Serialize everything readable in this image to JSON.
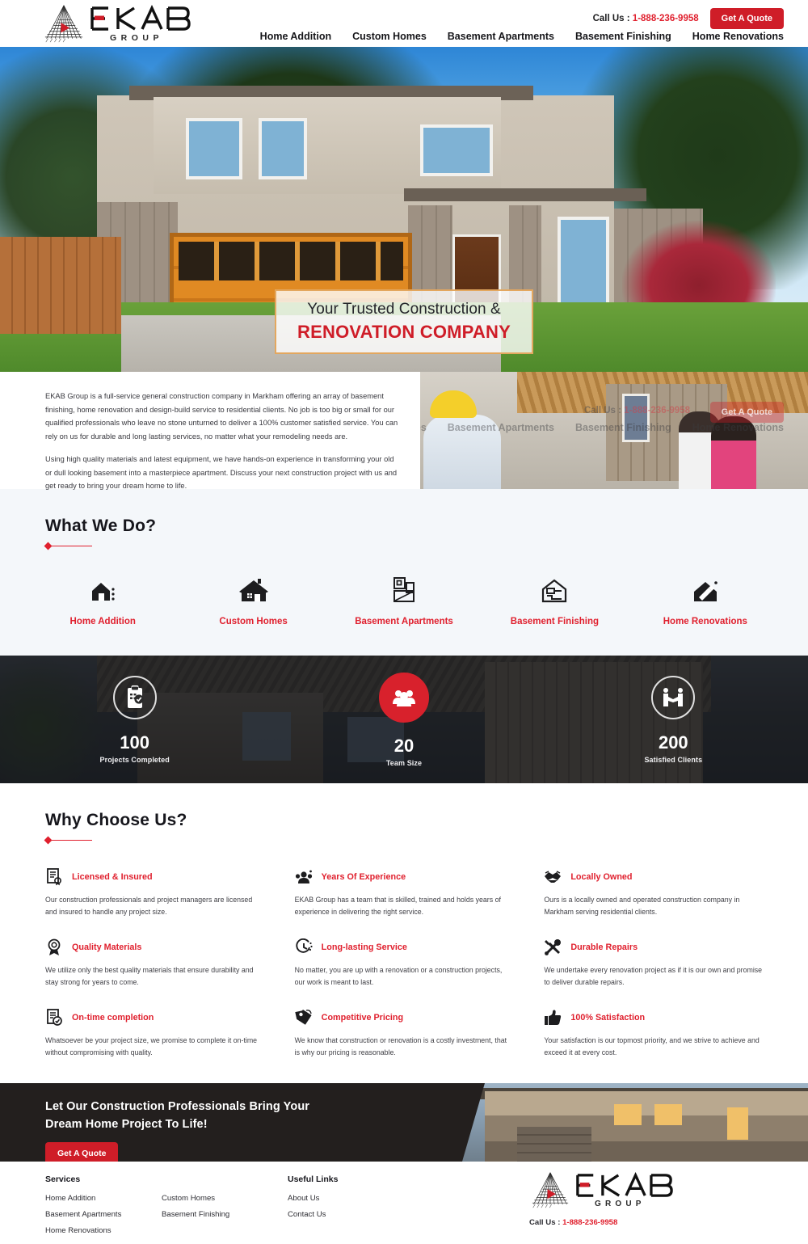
{
  "header": {
    "logo": {
      "word": "EKAB",
      "sub": "GROUP",
      "icon": "ekab-fan-logo"
    },
    "call_label": "Call Us :",
    "phone": "1-888-236-9958",
    "quote_button": "Get A Quote",
    "nav": [
      {
        "label": "Home Addition"
      },
      {
        "label": "Custom Homes"
      },
      {
        "label": "Basement Apartments"
      },
      {
        "label": "Basement Finishing"
      },
      {
        "label": "Home Renovations"
      }
    ]
  },
  "hero": {
    "line1": "Your Trusted Construction &",
    "line2": "RENOVATION COMPANY",
    "image_alt": "modern-home-exterior-with-wood-garage-door"
  },
  "intro": {
    "paragraph1": "EKAB Group is a full-service general construction company in Markham offering an array of basement finishing, home renovation and design-build service to residential clients. No job is too big or small for our qualified professionals who leave no stone unturned to deliver a 100% customer satisfied service. You can rely on us for durable and long lasting services, no matter what your remodeling needs are.",
    "paragraph2": "Using high quality materials and latest equipment, we have hands-on experience in transforming your old or dull looking basement into a masterpiece apartment. Discuss your next construction project with us and get ready to bring your dream home to life.",
    "image_alt": "contractor-in-yellow-hardhat-with-clients-at-construction-site"
  },
  "what_we_do": {
    "title": "What We Do?",
    "services": [
      {
        "label": "Home Addition",
        "icon": "house-addition-icon"
      },
      {
        "label": "Custom Homes",
        "icon": "house-icon"
      },
      {
        "label": "Basement Apartments",
        "icon": "basement-apartment-icon"
      },
      {
        "label": "Basement Finishing",
        "icon": "basement-finishing-icon"
      },
      {
        "label": "Home Renovations",
        "icon": "house-renovation-icon"
      }
    ]
  },
  "stats": [
    {
      "number": "100",
      "label": "Projects Completed",
      "icon": "clipboard-check-icon",
      "highlight": false
    },
    {
      "number": "20",
      "label": "Team Size",
      "icon": "people-group-icon",
      "highlight": true
    },
    {
      "number": "200",
      "label": "Satisfied Clients",
      "icon": "handshake-icon",
      "highlight": false
    }
  ],
  "why_choose_us": {
    "title": "Why Choose Us?",
    "features": [
      {
        "title": "Licensed & Insured",
        "icon": "certificate-icon",
        "body": "Our construction professionals and project managers are licensed and insured to handle any project size."
      },
      {
        "title": "Years Of Experience",
        "icon": "team-experience-icon",
        "body": "EKAB Group has a team that is skilled, trained and holds years of experience in delivering the right service."
      },
      {
        "title": "Locally Owned",
        "icon": "handshake-local-icon",
        "body": "Ours is a locally owned and operated construction company in Markham serving residential clients."
      },
      {
        "title": "Quality Materials",
        "icon": "award-ribbon-icon",
        "body": "We utilize only the best quality materials that ensure durability and stay strong for years to come."
      },
      {
        "title": "Long-lasting Service",
        "icon": "clock-icon",
        "body": "No matter, you are up with a renovation or a construction projects, our work is meant to last."
      },
      {
        "title": "Durable Repairs",
        "icon": "wrench-screwdriver-icon",
        "body": "We undertake every renovation project as if it is our own and promise to deliver durable repairs."
      },
      {
        "title": "On-time completion",
        "icon": "document-check-icon",
        "body": "Whatsoever be your project size, we promise to complete it on-time without compromising with quality."
      },
      {
        "title": "Competitive Pricing",
        "icon": "price-tag-icon",
        "body": "We know that construction or renovation is a costly investment, that is why our pricing is reasonable."
      },
      {
        "title": "100% Satisfaction",
        "icon": "thumbs-up-icon",
        "body": "Your satisfaction is our topmost priority, and we strive to achieve and exceed it at every cost."
      }
    ]
  },
  "cta": {
    "line1": "Let Our Construction Professionals Bring Your",
    "line2": "Dream Home Project To Life!",
    "button": "Get A Quote",
    "image_alt": "modern-home-at-dusk-with-lit-garage"
  },
  "footer": {
    "services_head": "Services",
    "services_col1": [
      "Home Addition",
      "Basement Apartments",
      "Home Renovations"
    ],
    "services_col2": [
      "Custom Homes",
      "Basement Finishing"
    ],
    "useful_head": "Useful Links",
    "useful_links": [
      "About Us",
      "Contact Us"
    ],
    "logo": {
      "word": "EKAB",
      "sub": "GROUP"
    },
    "call_label": "Call Us :",
    "phone": "1-888-236-9958"
  },
  "colors": {
    "brand_red": "#cf1d28",
    "accent_red": "#e0202e",
    "dark": "#231f1e",
    "panel": "#f4f7fa"
  }
}
